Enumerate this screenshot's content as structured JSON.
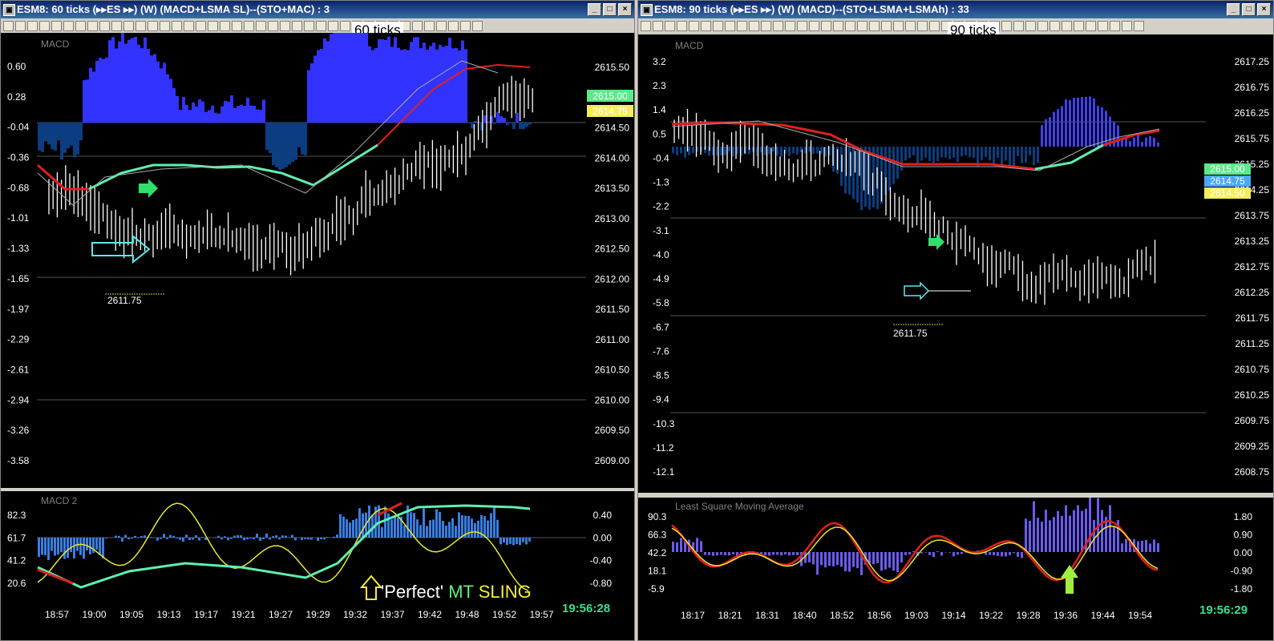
{
  "left": {
    "title": "ESM8: 60 ticks (▸▸ES ▸▸) (W)  (MACD+LSMA SL)--(STO+MAC) : 3",
    "callout": "60 ticks",
    "main_panel_label": "MACD",
    "sub_panel_label": "MACD 2",
    "left_axis": [
      "0.60",
      "0.28",
      "-0.04",
      "-0.36",
      "-0.68",
      "-1.01",
      "-1.33",
      "-1.65",
      "-1.97",
      "-2.29",
      "-2.61",
      "-2.94",
      "-3.26",
      "-3.58"
    ],
    "right_axis": [
      "2615.50",
      "2615.00",
      "2614.50",
      "2614.00",
      "2613.50",
      "2613.00",
      "2612.50",
      "2612.00",
      "2611.50",
      "2611.00",
      "2610.50",
      "2610.00",
      "2609.50",
      "2609.00"
    ],
    "price_boxes": [
      {
        "text": "2615.00",
        "color": "#5de88a"
      },
      {
        "text": "2614.75",
        "color": "#f5ee5a"
      }
    ],
    "level_label": "2611.75",
    "sub_left_axis": [
      "82.3",
      "61.7",
      "41.2",
      "20.6"
    ],
    "sub_right_axis": [
      "0.40",
      "0.00",
      "-0.40",
      "-0.80"
    ],
    "time_axis": [
      "18:57",
      "19:00",
      "19:05",
      "19:13",
      "19:17",
      "19:21",
      "19:27",
      "19:29",
      "19:32",
      "19:37",
      "19:42",
      "19:48",
      "19:52",
      "19:57"
    ],
    "clock": "19:56:28",
    "annotation": {
      "part1": "'Perfect' ",
      "part2": "MT ",
      "part3": "SLING"
    }
  },
  "right": {
    "title": "ESM8: 90 ticks (▸▸ES ▸▸) (W)  (MACD)--(STO+LSMA+LSMAh) : 33",
    "callout": "90 ticks",
    "main_panel_label": "MACD",
    "sub_panel_label": "Least Square Moving Average",
    "left_axis": [
      "3.2",
      "2.3",
      "1.4",
      "0.5",
      "-0.4",
      "-1.3",
      "-2.2",
      "-3.1",
      "-4.0",
      "-4.9",
      "-5.8",
      "-6.7",
      "-7.6",
      "-8.5",
      "-9.4",
      "-10.3",
      "-11.2",
      "-12.1"
    ],
    "right_axis": [
      "2617.25",
      "2616.75",
      "2616.25",
      "2615.75",
      "2615.25",
      "2614.25",
      "2613.75",
      "2613.25",
      "2612.75",
      "2612.25",
      "2611.75",
      "2611.25",
      "2610.75",
      "2610.25",
      "2609.75",
      "2609.25",
      "2608.75"
    ],
    "price_boxes": [
      {
        "text": "2615.00",
        "color": "#5de88a"
      },
      {
        "text": "2614.75",
        "color": "#4aa8ff"
      },
      {
        "text": "2614.50",
        "color": "#f5ee5a"
      }
    ],
    "level_label": "2611.75",
    "sub_left_axis": [
      "90.3",
      "66.3",
      "42.2",
      "18.1",
      "-5.9"
    ],
    "sub_right_axis": [
      "1.80",
      "0.90",
      "0.00",
      "-0.90",
      "-1.80"
    ],
    "time_axis": [
      "18:17",
      "18:21",
      "18:31",
      "18:40",
      "18:52",
      "18:56",
      "19:03",
      "19:14",
      "19:22",
      "19:28",
      "19:36",
      "19:44",
      "19:54"
    ],
    "clock": "19:56:29"
  },
  "colors": {
    "histo_pos": "#3333ff",
    "histo_neg": "#0c3d80",
    "lsma_up": "#5ff0b0",
    "lsma_dn": "#e02020",
    "sto": "#e8e830",
    "clock": "#39e08c"
  },
  "icons": [
    "app-icon",
    "minimize-icon",
    "maximize-icon",
    "close-icon",
    "arrow-up-icon",
    "arrow-right-icon"
  ]
}
